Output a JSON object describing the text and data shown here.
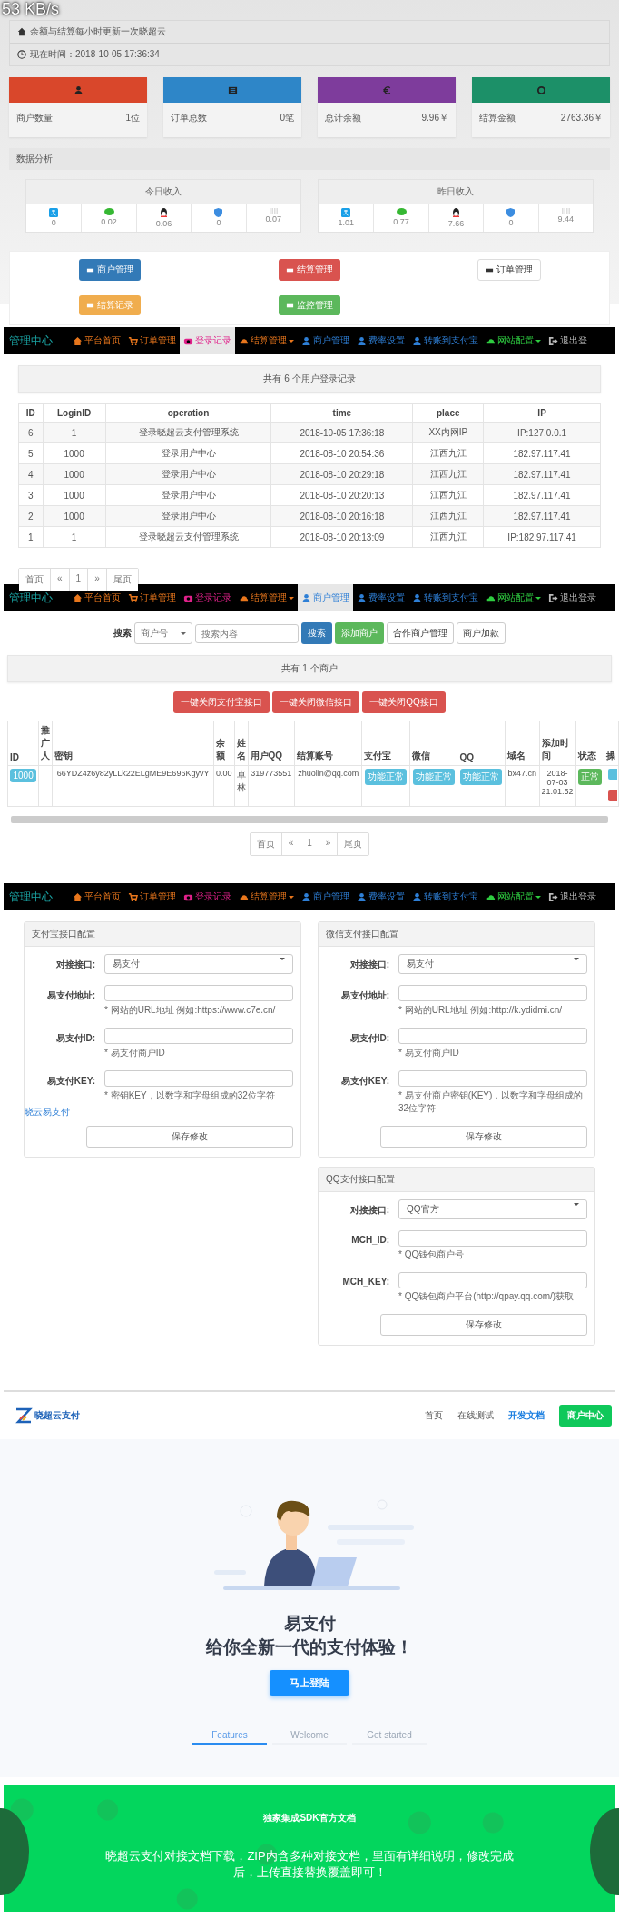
{
  "status_overlay": {
    "speed": "53 KB/s"
  },
  "dashboard": {
    "notice": "余额与结算每小时更新一次晓超云",
    "time": "现在时间：2018-10-05 17:36:34",
    "stats": [
      {
        "label": "商户数量",
        "value": "1位",
        "color": "#d9472b"
      },
      {
        "label": "订单总数",
        "value": "0笔",
        "color": "#2e86c8"
      },
      {
        "label": "总计余额",
        "value": "9.96￥",
        "color": "#7e3c9c"
      },
      {
        "label": "结算金额",
        "value": "2763.36￥",
        "color": "#1c9068"
      }
    ],
    "analysis_title": "数据分析",
    "income": [
      {
        "title": "今日收入",
        "values": [
          "0",
          "0.02",
          "0.06",
          "0",
          "0.07"
        ]
      },
      {
        "title": "昨日收入",
        "values": [
          "1.01",
          "0.77",
          "7.66",
          "0",
          "9.44"
        ]
      }
    ],
    "shortcuts": [
      {
        "label": "商户管理",
        "color": "#337ab7"
      },
      {
        "label": "结算管理",
        "color": "#d9534f"
      },
      {
        "label": "订单管理",
        "color": "#ffffff"
      },
      {
        "label": "结算记录",
        "color": "#f0ad4e"
      },
      {
        "label": "监控管理",
        "color": "#5cb85c"
      }
    ]
  },
  "login_log": {
    "nav": {
      "brand": "管理中心",
      "items": [
        {
          "label": "平台首页",
          "color": "#e8761c",
          "dropdown": false,
          "selected": false
        },
        {
          "label": "订单管理",
          "color": "#e8761c",
          "dropdown": false,
          "selected": false
        },
        {
          "label": "登录记录",
          "color": "#e0218a",
          "dropdown": false,
          "selected": true
        },
        {
          "label": "结算管理",
          "color": "#e8761c",
          "dropdown": true,
          "selected": false
        },
        {
          "label": "商户管理",
          "color": "#2e7fd6",
          "dropdown": false,
          "selected": false
        },
        {
          "label": "费率设置",
          "color": "#2e7fd6",
          "dropdown": false,
          "selected": false
        },
        {
          "label": "转账到支付宝",
          "color": "#2e7fd6",
          "dropdown": false,
          "selected": false
        },
        {
          "label": "网站配置",
          "color": "#2ecc40",
          "dropdown": true,
          "selected": false
        },
        {
          "label": "退出登",
          "color": "#bbbbbb",
          "dropdown": false,
          "selected": false
        }
      ]
    },
    "summary": "共有 6 个用户登录记录",
    "columns": [
      "ID",
      "LoginID",
      "operation",
      "time",
      "place",
      "IP"
    ],
    "rows": [
      [
        "6",
        "1",
        "登录晓超云支付管理系统",
        "2018-10-05 17:36:18",
        "XX内网IP",
        "IP:127.0.0.1"
      ],
      [
        "5",
        "1000",
        "登录用户中心",
        "2018-08-10 20:54:36",
        "江西九江",
        "182.97.117.41"
      ],
      [
        "4",
        "1000",
        "登录用户中心",
        "2018-08-10 20:29:18",
        "江西九江",
        "182.97.117.41"
      ],
      [
        "3",
        "1000",
        "登录用户中心",
        "2018-08-10 20:20:13",
        "江西九江",
        "182.97.117.41"
      ],
      [
        "2",
        "1000",
        "登录用户中心",
        "2018-08-10 20:16:18",
        "江西九江",
        "182.97.117.41"
      ],
      [
        "1",
        "1",
        "登录晓超云支付管理系统",
        "2018-08-10 20:13:09",
        "江西九江",
        "IP:182.97.117.41"
      ]
    ],
    "pagination": [
      "首页",
      "«",
      "1",
      "»",
      "尾页"
    ]
  },
  "merchants": {
    "nav": {
      "brand": "管理中心",
      "items": [
        {
          "label": "平台首页",
          "color": "#e8761c",
          "dropdown": false,
          "selected": false
        },
        {
          "label": "订单管理",
          "color": "#e8761c",
          "dropdown": false,
          "selected": false
        },
        {
          "label": "登录记录",
          "color": "#e0218a",
          "dropdown": false,
          "selected": false
        },
        {
          "label": "结算管理",
          "color": "#e8761c",
          "dropdown": true,
          "selected": false
        },
        {
          "label": "商户管理",
          "color": "#2e7fd6",
          "dropdown": false,
          "selected": true
        },
        {
          "label": "费率设置",
          "color": "#2e7fd6",
          "dropdown": false,
          "selected": false
        },
        {
          "label": "转账到支付宝",
          "color": "#2e7fd6",
          "dropdown": false,
          "selected": false
        },
        {
          "label": "网站配置",
          "color": "#2ecc40",
          "dropdown": true,
          "selected": false
        },
        {
          "label": "退出登录",
          "color": "#bbbbbb",
          "dropdown": false,
          "selected": false
        }
      ]
    },
    "search": {
      "label": "搜索",
      "select": "商户号",
      "placeholder": "搜索内容",
      "buttons": [
        {
          "label": "搜索",
          "color": "#337ab7"
        },
        {
          "label": "添加商户",
          "color": "#5cb85c"
        },
        {
          "label": "合作商户管理",
          "color": "#ffffff"
        },
        {
          "label": "商户加款",
          "color": "#ffffff"
        }
      ]
    },
    "summary": "共有 1 个商户",
    "bulk_buttons": [
      "一键关闭支付宝接口",
      "一键关闭微信接口",
      "一键关闭QQ接口"
    ],
    "columns": [
      "ID",
      "推广人",
      "密钥",
      "余额",
      "姓名",
      "用户QQ",
      "结算账号",
      "支付宝",
      "微信",
      "QQ",
      "域名",
      "添加时间",
      "状态",
      "操"
    ],
    "rows": [
      {
        "id": "1000",
        "referrer": "",
        "key": "66YDZ4z6y82yLLk22ELgME9E696KgyvY",
        "balance": "0.00",
        "name": "卓林",
        "qq": "319773551",
        "account": "zhuolin@qq.com",
        "alipay": "功能正常",
        "wechat": "功能正常",
        "qqpay": "功能正常",
        "domain": "bx47.cn",
        "added": "2018-07-03 21:01:52",
        "status": "正常"
      }
    ],
    "pagination": [
      "首页",
      "«",
      "1",
      "»",
      "尾页"
    ]
  },
  "payment_config": {
    "nav": {
      "brand": "管理中心",
      "items": [
        {
          "label": "平台首页",
          "color": "#e8761c",
          "dropdown": false,
          "selected": false
        },
        {
          "label": "订单管理",
          "color": "#e8761c",
          "dropdown": false,
          "selected": false
        },
        {
          "label": "登录记录",
          "color": "#e0218a",
          "dropdown": false,
          "selected": false
        },
        {
          "label": "结算管理",
          "color": "#e8761c",
          "dropdown": true,
          "selected": false
        },
        {
          "label": "商户管理",
          "color": "#2e7fd6",
          "dropdown": false,
          "selected": false
        },
        {
          "label": "费率设置",
          "color": "#2e7fd6",
          "dropdown": false,
          "selected": false
        },
        {
          "label": "转账到支付宝",
          "color": "#2e7fd6",
          "dropdown": false,
          "selected": false
        },
        {
          "label": "网站配置",
          "color": "#2ecc40",
          "dropdown": true,
          "selected": false
        },
        {
          "label": "退出登录",
          "color": "#bbbbbb",
          "dropdown": false,
          "selected": false
        }
      ]
    },
    "panels": [
      {
        "title": "支付宝接口配置",
        "fields": [
          {
            "kind": "select",
            "label": "对接接口:",
            "value": "易支付"
          },
          {
            "kind": "input",
            "label": "易支付地址:",
            "hint": "* 网站的URL地址 例如:https://www.c7e.cn/"
          },
          {
            "kind": "input",
            "label": "易支付ID:",
            "hint": "* 易支付商户ID"
          },
          {
            "kind": "input",
            "label": "易支付KEY:",
            "hint": "* 密钥KEY，以数字和字母组成的32位字符"
          }
        ],
        "link": "晓云易支付",
        "save": "保存修改"
      },
      {
        "title": "微信支付接口配置",
        "fields": [
          {
            "kind": "select",
            "label": "对接接口:",
            "value": "易支付"
          },
          {
            "kind": "input",
            "label": "易支付地址:",
            "hint": "* 网站的URL地址 例如:http://k.ydidmi.cn/"
          },
          {
            "kind": "input",
            "label": "易支付ID:",
            "hint": "* 易支付商户ID"
          },
          {
            "kind": "input",
            "label": "易支付KEY:",
            "hint": "* 易支付商户密钥(KEY)，以数字和字母组成的32位字符"
          }
        ],
        "save": "保存修改"
      },
      {
        "title": "QQ支付接口配置",
        "fields": [
          {
            "kind": "select",
            "label": "对接接口:",
            "value": "QQ官方"
          },
          {
            "kind": "input",
            "label": "MCH_ID:",
            "hint": "* QQ钱包商户号"
          },
          {
            "kind": "input",
            "label": "MCH_KEY:",
            "hint": "* QQ钱包商户平台(http://qpay.qq.com/)获取"
          }
        ],
        "save": "保存修改"
      }
    ]
  },
  "landing": {
    "logo": "晓超云支付",
    "nav": [
      {
        "label": "首页",
        "selected": false
      },
      {
        "label": "在线测试",
        "selected": false
      },
      {
        "label": "开发文档",
        "selected": true
      }
    ],
    "cta_nav": "商户中心",
    "hero_title": "易支付",
    "hero_subtitle": "给你全新一代的支付体验！",
    "hero_button": "马上登陆",
    "tabs": [
      {
        "label": "Features",
        "selected": true
      },
      {
        "label": "Welcome",
        "selected": false
      },
      {
        "label": "Get started",
        "selected": false
      }
    ],
    "band_title": "独家集成SDK官方文档",
    "band_text": "晓超云支付对接文档下载，ZIP内含多种对接文档，里面有详细说明，修改完成后，上传直接替换覆盖即可！"
  }
}
